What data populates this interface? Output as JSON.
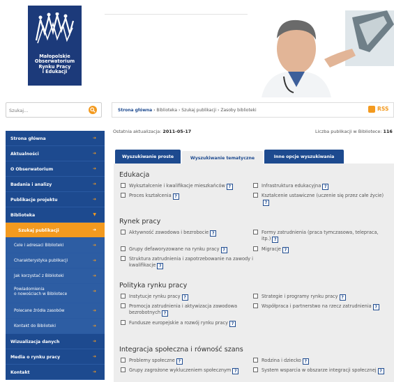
{
  "logo": {
    "lines": [
      "Małopolskie",
      "Obserwatorium",
      "Rynku Pracy",
      "i Edukacji"
    ]
  },
  "search": {
    "placeholder": "Szukaj..."
  },
  "nav": {
    "items": [
      {
        "label": "Strona główna"
      },
      {
        "label": "Aktualności"
      },
      {
        "label": "O Obserwatorium"
      },
      {
        "label": "Badania i analizy"
      },
      {
        "label": "Publikacje projektu"
      },
      {
        "label": "Biblioteka"
      }
    ],
    "active": "Szukaj publikacji",
    "sub": [
      {
        "label": "Cele i adresaci Biblioteki"
      },
      {
        "label": "Charakterystyka publikacji"
      },
      {
        "label": "Jak korzystać z Biblioteki"
      },
      {
        "label_1": "Powiadomienia",
        "label_2": "o nowościach w Bibliotece"
      },
      {
        "label": "Polecane źródła zasobów"
      },
      {
        "label": "Kontakt do Biblioteki"
      }
    ],
    "bottom": [
      {
        "label": "Wizualizacja danych"
      },
      {
        "label": "Media o rynku pracy"
      },
      {
        "label": "Kontakt"
      }
    ]
  },
  "breadcrumb": {
    "home": "Strona główna",
    "rest": " › Biblioteka › Szukaj publikacji › Zasoby biblioteki"
  },
  "rss_label": "RSS",
  "update": {
    "label": "Ostatnia aktualizacja: ",
    "date": "2011-05-17"
  },
  "count": {
    "label": "Liczba publikacji w Bibliotece: ",
    "value": "116"
  },
  "tabs": [
    "Wyszukiwanie proste",
    "Wyszukiwanie tematyczne",
    "Inne opcje wyszukiwania"
  ],
  "help_label": "?",
  "sections": [
    {
      "title": "Edukacja",
      "left": [
        "Wykształcenie i kwalifikacje mieszkańców",
        "Proces kształcenia"
      ],
      "right": [
        "Infrastruktura edukacyjna",
        "Kształcenie ustawiczne (uczenie się przez całe życie)"
      ]
    },
    {
      "title": "Rynek pracy",
      "left": [
        "Aktywność zawodowa i bezrobocie",
        "Grupy defaworyzowane na rynku pracy",
        "Struktura zatrudnienia i zapotrzebowanie na zawody i kwalifikacje"
      ],
      "right": [
        "Formy zatrudnienia (praca tymczasowa, telepraca, itp.)",
        "Migracje"
      ]
    },
    {
      "title": "Polityka rynku pracy",
      "left": [
        "Instytucje rynku pracy",
        "Promocja zatrudnienia i aktywizacja zawodowa bezrobotnych",
        "Fundusze europejskie a rozwój rynku pracy"
      ],
      "right": [
        "Strategie i programy rynku pracy",
        "Współpraca i partnerstwo na rzecz zatrudnienia"
      ]
    },
    {
      "title": "Integracja społeczna i równość szans",
      "left": [
        "Problemy społeczne",
        "Grupy zagrożone wykluczeniem społecznym"
      ],
      "right": [
        "Rodzina i dziecko",
        "System wsparcia w obszarze integracji społecznej"
      ]
    }
  ]
}
